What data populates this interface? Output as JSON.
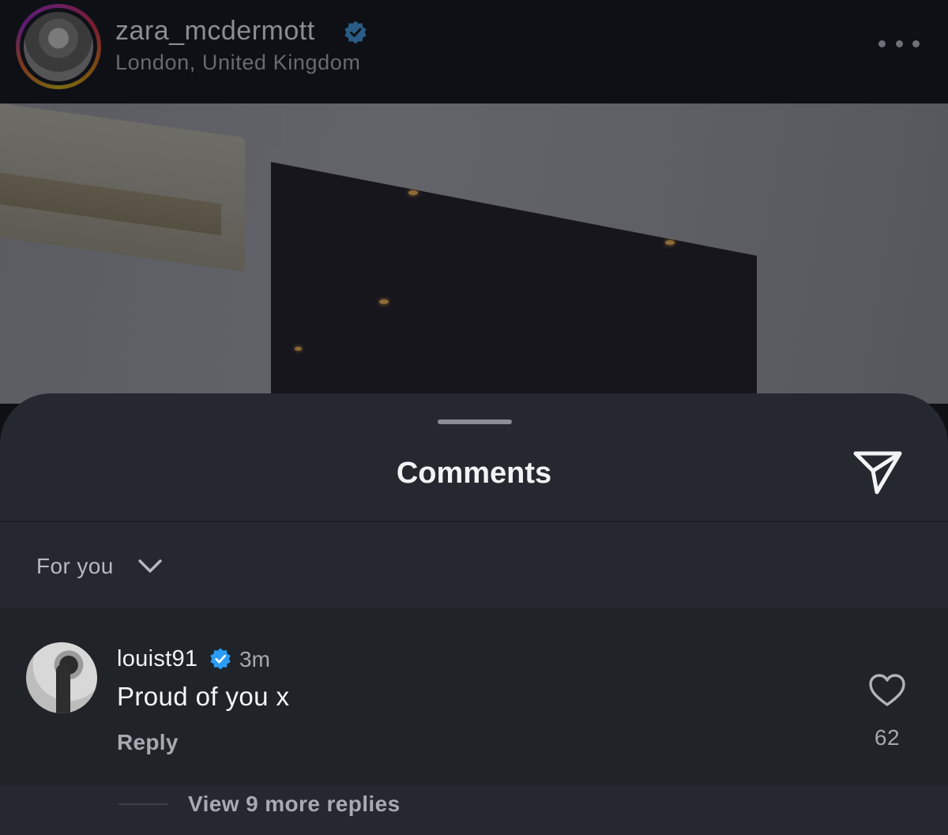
{
  "post": {
    "username": "zara_mcdermott",
    "location": "London, United Kingdom",
    "verified": true
  },
  "icons": {
    "verified": "verified-badge-icon",
    "more": "more-options-icon",
    "share": "paper-plane-icon",
    "chevron": "chevron-down-icon",
    "like": "heart-icon"
  },
  "colors": {
    "sheet": "#25282e",
    "comment_row": "#202328",
    "verified_blue": "#2b9cf4"
  },
  "sheet": {
    "title": "Comments",
    "filter": "For you"
  },
  "comments": [
    {
      "username": "louist91",
      "verified": true,
      "time": "3m",
      "text": "Proud of you x",
      "reply_label": "Reply",
      "likes": "62",
      "view_replies": "View 9 more replies"
    }
  ]
}
